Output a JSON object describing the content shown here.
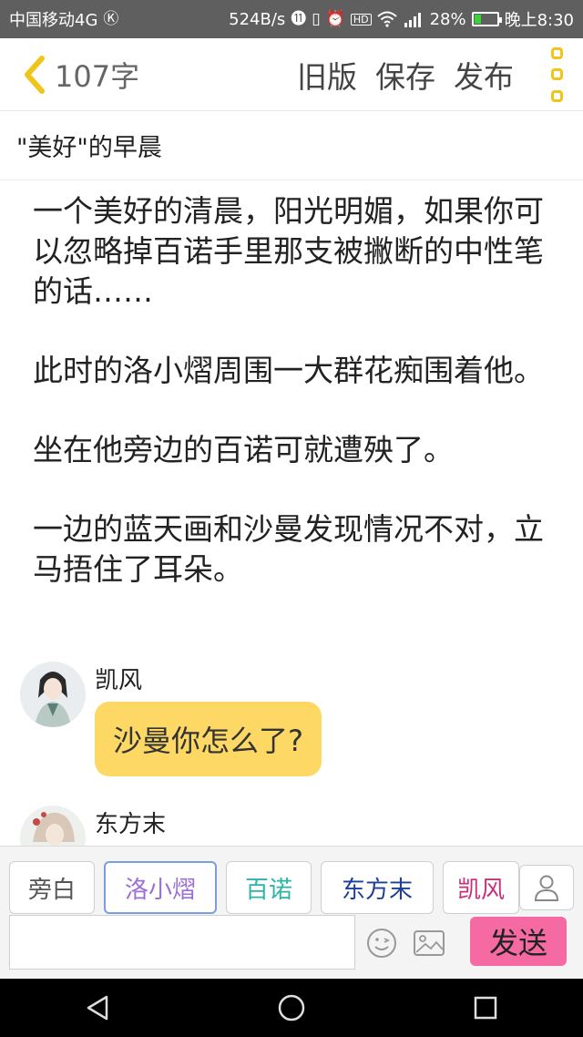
{
  "status_bar": {
    "carrier": "中国移动4G",
    "carrier_icon": "Ⓚ",
    "speed": "524B/s",
    "battery": "28%",
    "time": "晚上8:30",
    "colors": {
      "background": "#5f5f5f",
      "battery_fill": "#3ad13a"
    }
  },
  "header": {
    "word_count": "107字",
    "actions": {
      "old_version": "旧版",
      "save": "保存",
      "publish": "发布"
    }
  },
  "story": {
    "title": "\"美好\"的早晨",
    "paragraphs": [
      "一个美好的清晨，阳光明媚，如果你可以忽略掉百诺手里那支被撇断的中性笔的话……",
      "此时的洛小熠周围一大群花痴围着他。",
      "坐在他旁边的百诺可就遭殃了。",
      "一边的蓝天画和沙曼发现情况不对，立马捂住了耳朵。"
    ],
    "messages": [
      {
        "name": "凯风",
        "text": "沙曼你怎么了?"
      },
      {
        "name": "东方末"
      }
    ]
  },
  "characters": {
    "chips": [
      {
        "label": "旁白",
        "color": "#555555"
      },
      {
        "label": "洛小熠",
        "color": "#9b6fd6",
        "selected": true
      },
      {
        "label": "百诺",
        "color": "#2bb5a6"
      },
      {
        "label": "东方末",
        "color": "#1e3f99"
      },
      {
        "label": "凯风",
        "color": "#c8307a"
      }
    ]
  },
  "composer": {
    "input_value": "",
    "send_label": "发送",
    "colors": {
      "send": "#f56aa3",
      "bubble": "#fdd865",
      "accent_menu": "#f0c419"
    }
  }
}
